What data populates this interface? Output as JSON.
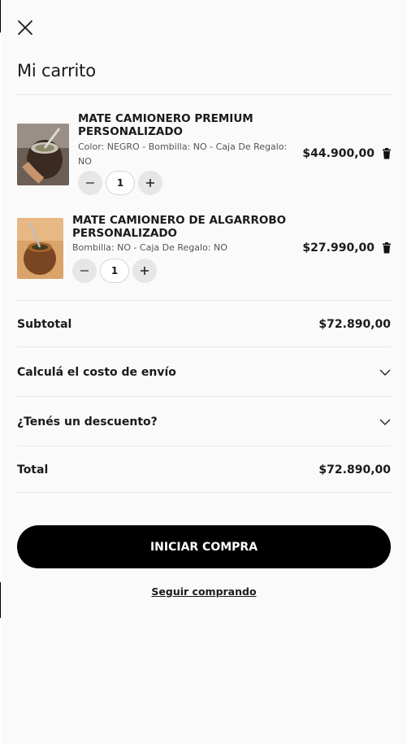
{
  "cart": {
    "title": "Mi carrito",
    "items": [
      {
        "name": "MATE CAMIONERO PREMIUM PERSONALIZADO",
        "variant": "Color: NEGRO - Bombilla: NO - Caja De Regalo: NO",
        "quantity": "1",
        "price": "$44.900,00",
        "thumbnail_icon": "mate-premium-photo"
      },
      {
        "name": "MATE CAMIONERO DE ALGARROBO PERSONALIZADO",
        "variant": "Bombilla: NO - Caja De Regalo: NO",
        "quantity": "1",
        "price": "$27.990,00",
        "thumbnail_icon": "mate-algarrobo-photo"
      }
    ],
    "subtotal": {
      "label": "Subtotal",
      "value": "$72.890,00"
    },
    "shipping": {
      "label": "Calculá el costo de envío"
    },
    "discount": {
      "label": "¿Tenés un descuento?"
    },
    "total": {
      "label": "Total",
      "value": "$72.890,00"
    },
    "checkout_label": "INICIAR COMPRA",
    "continue_label": "Seguir comprando"
  },
  "colors": {
    "panel_bg": "#fafafa",
    "primary": "#000000",
    "qty_button": "#e6e6e6",
    "divider": "#e6e6e6"
  }
}
